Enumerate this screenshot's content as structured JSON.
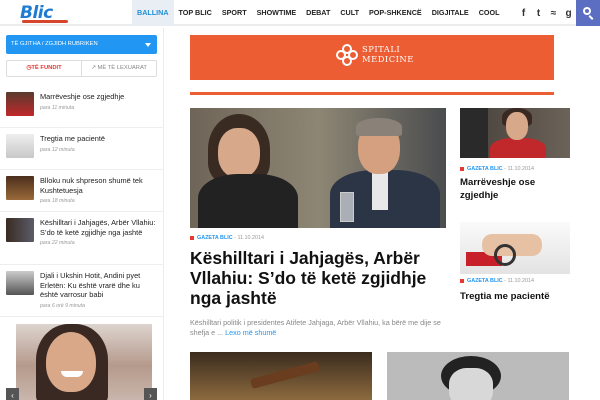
{
  "header": {
    "logo_text": "Blic",
    "nav": [
      "BALLINA",
      "TOP BLIC",
      "SPORT",
      "SHOWTIME",
      "DEBAT",
      "CULT",
      "POP-SHKENCË",
      "DIGJITALE",
      "COOL"
    ],
    "social": [
      {
        "icon": "facebook-icon",
        "glyph": "f"
      },
      {
        "icon": "twitter-icon",
        "glyph": "t"
      },
      {
        "icon": "rss-icon",
        "glyph": "≈"
      },
      {
        "icon": "google-plus-icon",
        "glyph": "g"
      }
    ],
    "search_icon": "search-icon"
  },
  "sidebar": {
    "dropdown_label": "TË GJITHA / ZGJIDH RUBRIKEN",
    "tabs": [
      "◷TË FUNDIT",
      "↗ MË TË LEXUARAT"
    ],
    "items": [
      {
        "title": "Marrëveshje ose zgjedhje",
        "time": "para 11 minuta"
      },
      {
        "title": "Tregtia me pacientë",
        "time": "para 12 minuta"
      },
      {
        "title": "Blloku nuk shpreson shumë tek Kushtetuesja",
        "time": "para 18 minuta"
      },
      {
        "title": "Këshilltari i Jahjagës, Arbër Vllahiu: S’do të ketë zgjidhje nga jashtë",
        "time": "para 22 minuta"
      },
      {
        "title": "Djali i Ukshin Hotit, Andini pyet Erletën: Ku është vrarë dhe ku është varrosur babi",
        "time": "para 6 orë 9 minuta"
      }
    ],
    "arrow_left": "‹",
    "arrow_right": "›"
  },
  "ad": {
    "line1": "SPITALI",
    "line2": "MEDICINE",
    "color": "#ec5d33"
  },
  "feature": {
    "source": "GAZETA BLIC",
    "date": "11.10.2014",
    "headline": "Këshilltari i Jahjagës, Arbër Vllahiu: S’do të ketë zgjidhje nga jashtë",
    "excerpt": "Këshilltari politik i presidentes Atifete Jahjaga, Arbër Vllahiu, ka bërë me dije se shefja e ...",
    "more": "Lexo më shumë"
  },
  "right": {
    "items": [
      {
        "source": "GAZETA BLIC",
        "date": "11.10.2014",
        "title": "Marrëveshje ose zgjedhje"
      },
      {
        "source": "GAZETA BLIC",
        "date": "11.10.2014",
        "title": "Tregtia me pacientë"
      }
    ]
  },
  "colors": {
    "accent_blue": "#2196f3",
    "accent_red": "#e53935",
    "search_bg": "#5c6ec2"
  }
}
